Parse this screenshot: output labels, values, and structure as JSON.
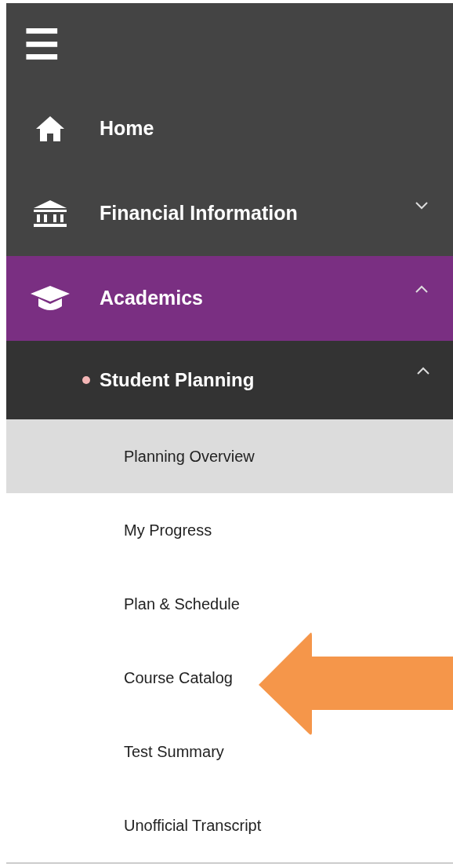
{
  "menu_button": {
    "label": "☰"
  },
  "nav": {
    "items": [
      {
        "label": "Home",
        "selected": false
      },
      {
        "label": "Financial Information",
        "selected": false,
        "expanded": false
      },
      {
        "label": "Academics",
        "selected": true,
        "expanded": true,
        "children": [
          {
            "label": "Student Planning",
            "expanded": true,
            "children": [
              {
                "label": "Planning Overview",
                "selected": true
              },
              {
                "label": "My Progress",
                "selected": false
              },
              {
                "label": "Plan & Schedule",
                "selected": false
              },
              {
                "label": "Course Catalog",
                "selected": false
              },
              {
                "label": "Test Summary",
                "selected": false
              },
              {
                "label": "Unofficial Transcript",
                "selected": false
              }
            ]
          }
        ]
      }
    ]
  }
}
